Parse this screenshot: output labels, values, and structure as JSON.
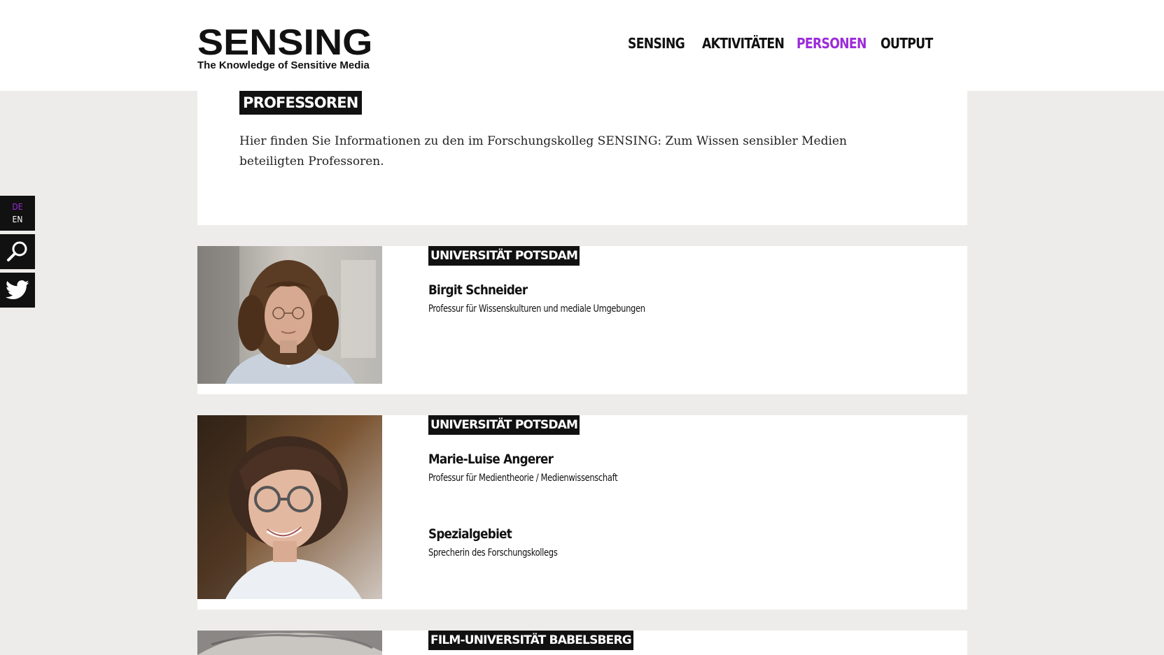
{
  "header": {
    "logo_title": "SENSING",
    "logo_subtitle": "The Knowledge of Sensitive Media",
    "nav": [
      {
        "label": "SENSING",
        "active": false
      },
      {
        "label": "AKTIVITÄTEN",
        "active": false
      },
      {
        "label": "PERSONEN",
        "active": true
      },
      {
        "label": "OUTPUT",
        "active": false
      }
    ]
  },
  "sidebar": {
    "lang_de": "DE",
    "lang_en": "EN",
    "search_icon": "search-icon",
    "twitter_icon": "twitter-icon"
  },
  "intro": {
    "heading": "PROFESSOREN",
    "text": "Hier finden Sie Informationen zu den im Forschungskolleg SENSING: Zum Wissen sensibler Medien beteiligten Professoren."
  },
  "people": [
    {
      "institution": "UNIVERSITÄT POTSDAM",
      "name": "Birgit Schneider",
      "role": "Professur für Wissenskulturen und mediale Umgebungen"
    },
    {
      "institution": "UNIVERSITÄT POTSDAM",
      "name": "Marie-Luise Angerer",
      "role": "Professur für Medientheorie / Medienwissenschaft",
      "extra_heading": "Spezialgebiet",
      "extra_text": "Sprecherin des Forschungskollegs"
    },
    {
      "institution": "FILM-UNIVERSITÄT BABELSBERG"
    }
  ],
  "colors": {
    "accent": "#9b2bd8",
    "background": "#edecea",
    "tag_bg": "#111111"
  }
}
